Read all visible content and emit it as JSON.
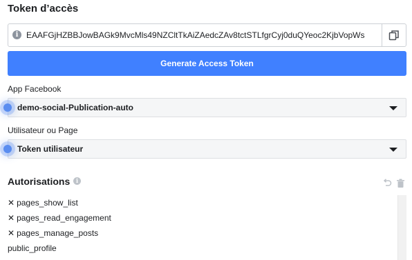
{
  "access_token": {
    "title": "Token d’accès",
    "info_icon": "info-icon",
    "value": "EAAFGjHZBBJowBAGk9MvcMls49NZCltTkAiZAedcZAv8tctSTLfgrCyj0duQYeoc2KjbVopWs",
    "copy_icon": "copy-icon",
    "generate_label": "Generate Access Token"
  },
  "app_select": {
    "label": "App Facebook",
    "value": "demo-social-Publication-auto"
  },
  "user_select": {
    "label": "Utilisateur ou Page",
    "value": "Token utilisateur"
  },
  "permissions": {
    "title": "Autorisations",
    "items": [
      {
        "name": "pages_show_list",
        "removable": true
      },
      {
        "name": "pages_read_engagement",
        "removable": true
      },
      {
        "name": "pages_manage_posts",
        "removable": true
      },
      {
        "name": "public_profile",
        "removable": false
      }
    ],
    "remove_glyph": "✕"
  },
  "colors": {
    "primary_button": "#4080ff",
    "focus_dot": "#5a8df0",
    "border": "#ccd0d5"
  }
}
